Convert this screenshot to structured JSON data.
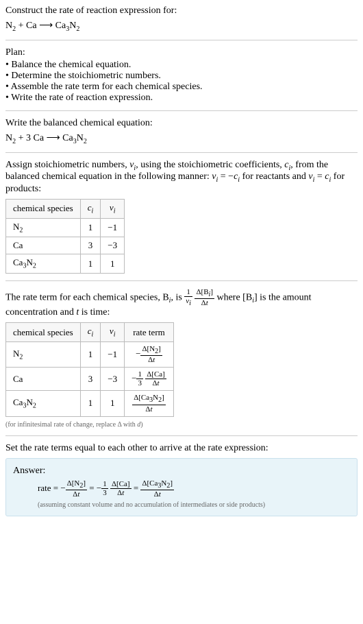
{
  "intro": {
    "line1": "Construct the rate of reaction expression for:",
    "eq_html": "N<span class='sub'>2</span> + Ca <span class='arrow'>⟶</span> Ca<span class='sub'>3</span>N<span class='sub'>2</span>"
  },
  "plan": {
    "label": "Plan:",
    "items": [
      "Balance the chemical equation.",
      "Determine the stoichiometric numbers.",
      "Assemble the rate term for each chemical species.",
      "Write the rate of reaction expression."
    ]
  },
  "balanced": {
    "label": "Write the balanced chemical equation:",
    "eq_html": "N<span class='sub'>2</span> + 3 Ca <span class='arrow'>⟶</span> Ca<span class='sub'>3</span>N<span class='sub'>2</span>"
  },
  "assign": {
    "text_html": "Assign stoichiometric numbers, <span class='italic'>ν<span class='sub'>i</span></span>, using the stoichiometric coefficients, <span class='italic'>c<span class='sub'>i</span></span>, from the balanced chemical equation in the following manner: <span class='italic'>ν<span class='sub'>i</span></span> = −<span class='italic'>c<span class='sub'>i</span></span> for reactants and <span class='italic'>ν<span class='sub'>i</span></span> = <span class='italic'>c<span class='sub'>i</span></span> for products:"
  },
  "table1": {
    "headers": [
      "chemical species",
      "c_i",
      "v_i"
    ],
    "header_html": [
      "chemical species",
      "<span class='italic'>c<span class='sub'>i</span></span>",
      "<span class='italic'>ν<span class='sub'>i</span></span>"
    ],
    "rows": [
      {
        "species_html": "N<span class='sub'>2</span>",
        "c": "1",
        "v": "−1"
      },
      {
        "species_html": "Ca",
        "c": "3",
        "v": "−3"
      },
      {
        "species_html": "Ca<span class='sub'>3</span>N<span class='sub'>2</span>",
        "c": "1",
        "v": "1"
      }
    ]
  },
  "rateterm": {
    "text_html": "The rate term for each chemical species, B<span class='sub italic'>i</span>, is <span class='frac'><span class='num'>1</span><span class='den italic'>ν<span class='sub'>i</span></span></span> <span class='frac'><span class='num'>Δ[B<span class='sub italic'>i</span>]</span><span class='den'>Δ<span class='italic'>t</span></span></span> where [B<span class='sub italic'>i</span>] is the amount concentration and <span class='italic'>t</span> is time:"
  },
  "table2": {
    "header_html": [
      "chemical species",
      "<span class='italic'>c<span class='sub'>i</span></span>",
      "<span class='italic'>ν<span class='sub'>i</span></span>",
      "rate term"
    ],
    "rows": [
      {
        "species_html": "N<span class='sub'>2</span>",
        "c": "1",
        "v": "−1",
        "rate_html": "−<span class='frac'><span class='num'>Δ[N<span class='sub'>2</span>]</span><span class='den'>Δ<span class='italic'>t</span></span></span>"
      },
      {
        "species_html": "Ca",
        "c": "3",
        "v": "−3",
        "rate_html": "−<span class='frac'><span class='num'>1</span><span class='den'>3</span></span> <span class='frac'><span class='num'>Δ[Ca]</span><span class='den'>Δ<span class='italic'>t</span></span></span>"
      },
      {
        "species_html": "Ca<span class='sub'>3</span>N<span class='sub'>2</span>",
        "c": "1",
        "v": "1",
        "rate_html": "<span class='frac'><span class='num'>Δ[Ca<span class='sub'>3</span>N<span class='sub'>2</span>]</span><span class='den'>Δ<span class='italic'>t</span></span></span>"
      }
    ],
    "note_html": "(for infinitesimal rate of change, replace Δ with <span class='italic'>d</span>)"
  },
  "final": {
    "label": "Set the rate terms equal to each other to arrive at the rate expression:"
  },
  "answer": {
    "label": "Answer:",
    "body_html": "rate = −<span class='frac'><span class='num'>Δ[N<span class='sub'>2</span>]</span><span class='den'>Δ<span class='italic'>t</span></span></span> = −<span class='frac'><span class='num'>1</span><span class='den'>3</span></span> <span class='frac'><span class='num'>Δ[Ca]</span><span class='den'>Δ<span class='italic'>t</span></span></span> = <span class='frac'><span class='num'>Δ[Ca<span class='sub'>3</span>N<span class='sub'>2</span>]</span><span class='den'>Δ<span class='italic'>t</span></span></span>",
    "note": "(assuming constant volume and no accumulation of intermediates or side products)"
  },
  "chart_data": {
    "type": "table",
    "tables": [
      {
        "title": "stoichiometric numbers",
        "columns": [
          "chemical species",
          "c_i",
          "v_i"
        ],
        "rows": [
          [
            "N2",
            1,
            -1
          ],
          [
            "Ca",
            3,
            -3
          ],
          [
            "Ca3N2",
            1,
            1
          ]
        ]
      },
      {
        "title": "rate terms",
        "columns": [
          "chemical species",
          "c_i",
          "v_i",
          "rate term"
        ],
        "rows": [
          [
            "N2",
            1,
            -1,
            "-Δ[N2]/Δt"
          ],
          [
            "Ca",
            3,
            -3,
            "-(1/3) Δ[Ca]/Δt"
          ],
          [
            "Ca3N2",
            1,
            1,
            "Δ[Ca3N2]/Δt"
          ]
        ]
      }
    ]
  }
}
